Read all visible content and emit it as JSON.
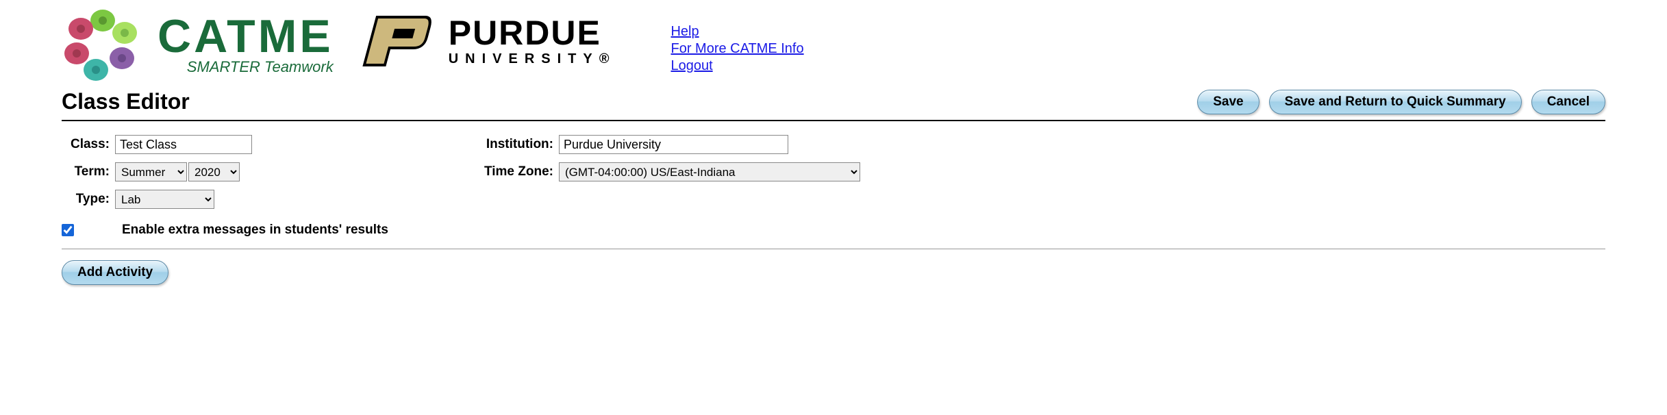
{
  "header": {
    "catme_title": "CATME",
    "catme_subtitle": "SMARTER Teamwork",
    "purdue_main": "PURDUE",
    "purdue_sub": "UNIVERSITY®",
    "links": {
      "help": "Help",
      "more": "For More CATME Info",
      "logout": "Logout"
    }
  },
  "page_title": "Class Editor",
  "buttons": {
    "save": "Save",
    "save_return": "Save and Return to Quick Summary",
    "cancel": "Cancel",
    "add_activity": "Add Activity"
  },
  "form": {
    "class_label": "Class:",
    "class_value": "Test Class",
    "term_label": "Term:",
    "term_value": "Summer",
    "year_value": "2020",
    "type_label": "Type:",
    "type_value": "Lab",
    "institution_label": "Institution:",
    "institution_value": "Purdue University",
    "timezone_label": "Time Zone:",
    "timezone_value": "(GMT-04:00:00) US/East-Indiana",
    "extra_messages_checked": true,
    "extra_messages_label": "Enable extra messages in students' results"
  }
}
